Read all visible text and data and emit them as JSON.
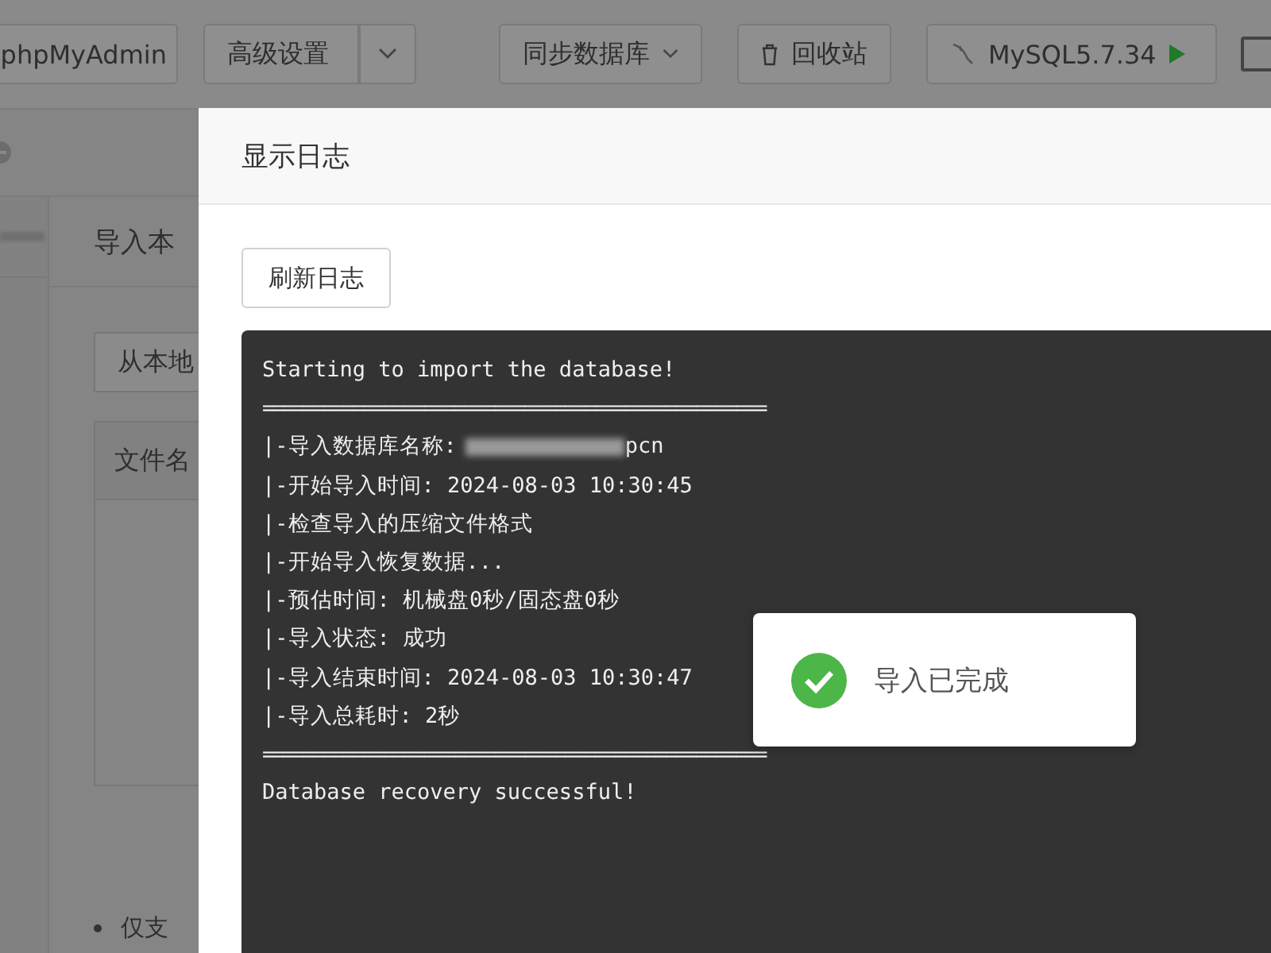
{
  "toolbar": {
    "buttons": [
      {
        "kind": "plain",
        "label": "phpMyAdmin"
      },
      {
        "kind": "split",
        "label": "高级设置"
      },
      {
        "kind": "dropdown",
        "label": "同步数据库"
      },
      {
        "kind": "trash",
        "label": "回收站"
      },
      {
        "kind": "mysql",
        "label": "MySQL5.7.34"
      }
    ]
  },
  "import_panel": {
    "title": "导入本",
    "upload_button": "从本地",
    "table": {
      "columns": [
        "文件名"
      ]
    },
    "note": "仅支"
  },
  "modal": {
    "title": "显示日志",
    "refresh_button": "刷新日志",
    "log": [
      {
        "kind": "plain",
        "text": "Starting to import the database!"
      },
      {
        "kind": "rule",
        "text": "=================================================="
      },
      {
        "kind": "redacted",
        "text": "|-导入数据库名称:",
        "suffix": "pcn"
      },
      {
        "kind": "plain",
        "text": "|-开始导入时间: 2024-08-03 10:30:45"
      },
      {
        "kind": "plain",
        "text": "|-检查导入的压缩文件格式"
      },
      {
        "kind": "plain",
        "text": "|-开始导入恢复数据..."
      },
      {
        "kind": "plain",
        "text": "|-预估时间: 机械盘0秒/固态盘0秒"
      },
      {
        "kind": "plain",
        "text": "|-导入状态: 成功"
      },
      {
        "kind": "plain",
        "text": "|-导入结束时间: 2024-08-03 10:30:47"
      },
      {
        "kind": "plain",
        "text": "|-导入总耗时: 2秒"
      },
      {
        "kind": "rule",
        "text": "=================================================="
      },
      {
        "kind": "plain",
        "text": "Database recovery successful!"
      }
    ]
  },
  "toast": {
    "kind": "success",
    "message": "导入已完成"
  }
}
